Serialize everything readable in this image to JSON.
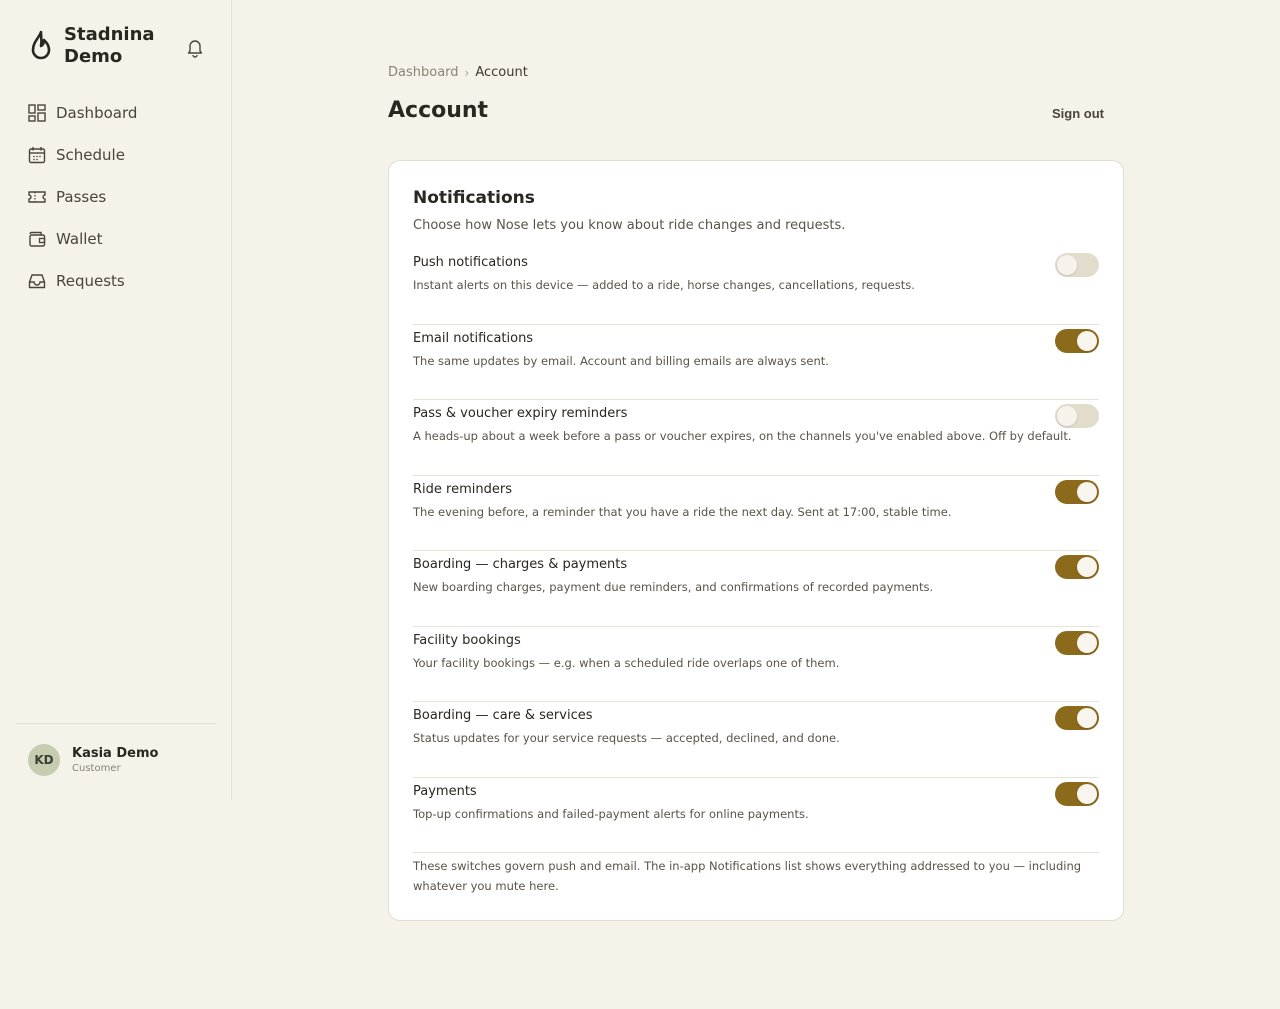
{
  "brand": {
    "name": "Stadnina Demo"
  },
  "nav": [
    {
      "label": "Dashboard",
      "icon": "dashboard-icon"
    },
    {
      "label": "Schedule",
      "icon": "calendar-icon"
    },
    {
      "label": "Passes",
      "icon": "ticket-icon"
    },
    {
      "label": "Wallet",
      "icon": "wallet-icon"
    },
    {
      "label": "Requests",
      "icon": "inbox-icon"
    }
  ],
  "user": {
    "initials": "KD",
    "name": "Kasia Demo",
    "role": "Customer"
  },
  "breadcrumb": {
    "parent": "Dashboard",
    "separator": "›",
    "current": "Account"
  },
  "page": {
    "title": "Account",
    "signout_label": "Sign out"
  },
  "notifications": {
    "title": "Notifications",
    "subtitle": "Choose how Nose lets you know about ride changes and requests.",
    "items": [
      {
        "title": "Push notifications",
        "desc": "Instant alerts on this device — added to a ride, horse changes, cancellations, requests.",
        "on": false
      },
      {
        "title": "Email notifications",
        "desc": "The same updates by email. Account and billing emails are always sent.",
        "on": true
      },
      {
        "title": "Pass & voucher expiry reminders",
        "desc": "A heads-up about a week before a pass or voucher expires, on the channels you've enabled above. Off by default.",
        "on": false
      },
      {
        "title": "Ride reminders",
        "desc": "The evening before, a reminder that you have a ride the next day. Sent at 17:00, stable time.",
        "on": true
      },
      {
        "title": "Boarding — charges & payments",
        "desc": "New boarding charges, payment due reminders, and confirmations of recorded payments.",
        "on": true
      },
      {
        "title": "Facility bookings",
        "desc": "Your facility bookings — e.g. when a scheduled ride overlaps one of them.",
        "on": true
      },
      {
        "title": "Boarding — care & services",
        "desc": "Status updates for your service requests — accepted, declined, and done.",
        "on": true
      },
      {
        "title": "Payments",
        "desc": "Top-up confirmations and failed-payment alerts for online payments.",
        "on": true
      }
    ],
    "footer": "These switches govern push and email. The in-app Notifications list shows everything addressed to you — including whatever you mute here."
  },
  "colors": {
    "accent": "#8c6a1c",
    "toggle_off": "#e2dccd",
    "background": "#f5f2ea"
  }
}
